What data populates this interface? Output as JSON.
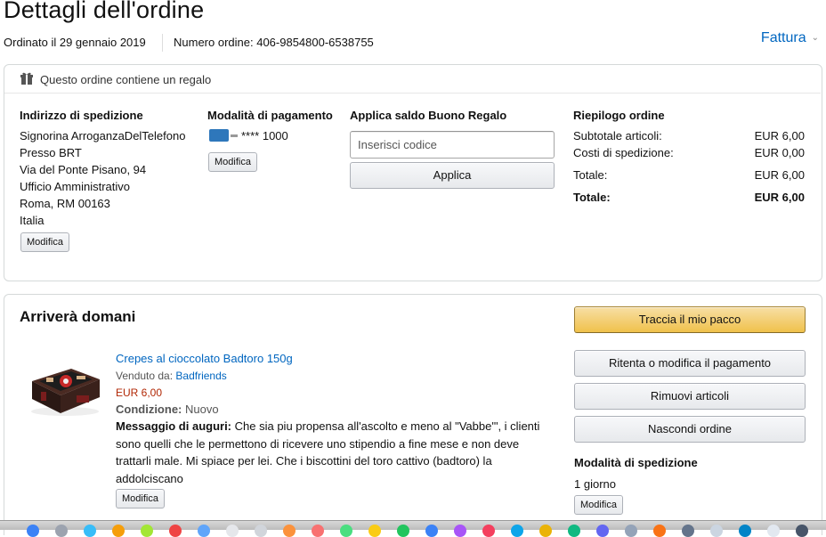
{
  "page": {
    "title": "Dettagli dell'ordine",
    "ordered_on": "Ordinato il 29 gennaio 2019",
    "order_number": "Numero ordine: 406-9854800-6538755",
    "invoice_link": "Fattura"
  },
  "gift_notice": "Questo ordine contiene un regalo",
  "shipping_address": {
    "heading": "Indirizzo di spedizione",
    "lines": [
      "Signorina ArroganzaDelTelefono",
      "Presso BRT",
      "Via del Ponte Pisano, 94",
      "Ufficio Amministrativo",
      "Roma, RM 00163",
      "Italia"
    ],
    "edit_label": "Modifica"
  },
  "payment": {
    "heading": "Modalità di pagamento",
    "card_masked": "**** 1000",
    "edit_label": "Modifica"
  },
  "gift_card": {
    "heading": "Applica saldo Buono Regalo",
    "placeholder": "Inserisci codice",
    "apply_label": "Applica"
  },
  "summary": {
    "heading": "Riepilogo ordine",
    "rows": [
      {
        "label": "Subtotale articoli:",
        "value": "EUR 6,00"
      },
      {
        "label": "Costi di spedizione:",
        "value": "EUR 0,00"
      },
      {
        "label": "Totale:",
        "value": "EUR 6,00"
      }
    ],
    "grand_total_label": "Totale:",
    "grand_total_value": "EUR 6,00"
  },
  "shipment": {
    "heading": "Arriverà domani",
    "product": {
      "name": "Crepes al cioccolato Badtoro 150g",
      "sold_by_label": "Venduto da:",
      "seller": "Badfriends",
      "price": "EUR 6,00",
      "condition_label": "Condizione:",
      "condition": "Nuovo",
      "gift_message_label": "Messaggio di auguri:",
      "gift_message": "Che sia piu propensa all'ascolto e meno al \"Vabbe'\", i clienti sono quelli che le permettono di ricevere uno stipendio a fine mese e non deve trattarli male. Mi spiace per lei. Che i biscottini del toro cattivo (badtoro) la addolciscano",
      "edit_label": "Modifica"
    },
    "actions": {
      "track": "Traccia il mio pacco",
      "retry_payment": "Ritenta o modifica il pagamento",
      "remove_items": "Rimuovi articoli",
      "hide_order": "Nascondi ordine"
    },
    "shipping_method": {
      "heading": "Modalità di spedizione",
      "value": "1 giorno",
      "edit_label": "Modifica"
    }
  },
  "colors": {
    "link": "#0066c0",
    "price": "#b12704",
    "track_button": "#f0c14b",
    "amex": "#2e77bb"
  }
}
